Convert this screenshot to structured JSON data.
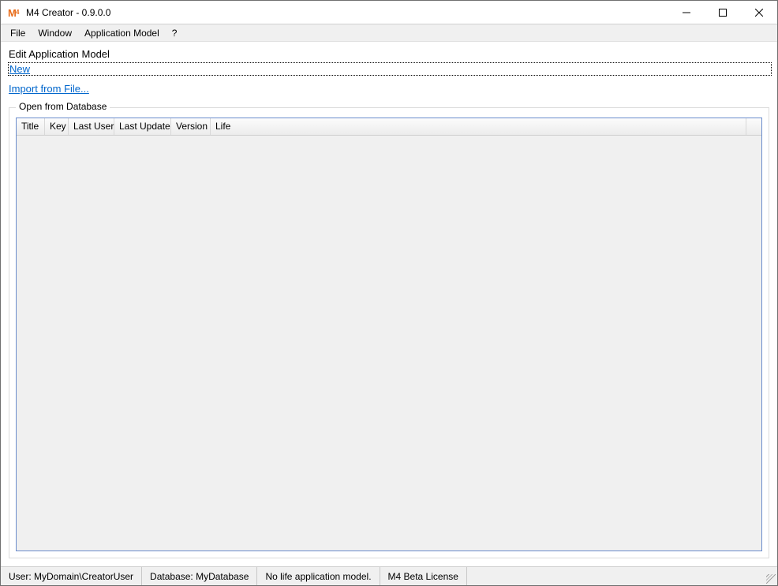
{
  "titlebar": {
    "title": "M4 Creator - 0.9.0.0"
  },
  "menu": {
    "file": "File",
    "window": "Window",
    "appmodel": "Application Model",
    "help": "?"
  },
  "main": {
    "heading": "Edit Application Model",
    "new_link": "New",
    "import_link": "Import from File...",
    "groupbox_label": "Open from Database",
    "columns": {
      "title": "Title",
      "key": "Key",
      "last_user": "Last User",
      "last_update": "Last Update",
      "version": "Version",
      "life": "Life"
    },
    "rows": []
  },
  "status": {
    "user": "User: MyDomain\\CreatorUser",
    "database": "Database: MyDatabase",
    "model": "No life application model.",
    "license": "M4 Beta License"
  }
}
